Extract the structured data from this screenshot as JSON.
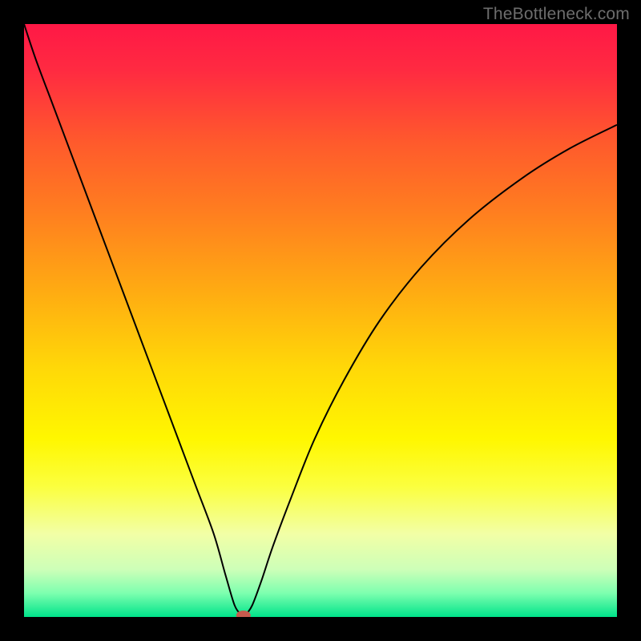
{
  "watermark": "TheBottleneck.com",
  "chart_data": {
    "type": "line",
    "title": "",
    "xlabel": "",
    "ylabel": "",
    "xlim": [
      0,
      100
    ],
    "ylim": [
      0,
      100
    ],
    "background_gradient": {
      "stops": [
        {
          "offset": 0.0,
          "color": "#ff1846"
        },
        {
          "offset": 0.08,
          "color": "#ff2b41"
        },
        {
          "offset": 0.2,
          "color": "#ff5a2c"
        },
        {
          "offset": 0.32,
          "color": "#ff7f1f"
        },
        {
          "offset": 0.45,
          "color": "#ffab12"
        },
        {
          "offset": 0.58,
          "color": "#ffd808"
        },
        {
          "offset": 0.7,
          "color": "#fff700"
        },
        {
          "offset": 0.78,
          "color": "#fbff3f"
        },
        {
          "offset": 0.86,
          "color": "#f2ffa6"
        },
        {
          "offset": 0.92,
          "color": "#cdffb8"
        },
        {
          "offset": 0.96,
          "color": "#7dffaf"
        },
        {
          "offset": 1.0,
          "color": "#00e38a"
        }
      ]
    },
    "series": [
      {
        "name": "bottleneck-curve",
        "color": "#000000",
        "stroke_width": 2,
        "x": [
          0,
          2,
          5,
          8,
          11,
          14,
          17,
          20,
          23,
          26,
          29,
          32,
          34,
          35.5,
          36.5,
          37,
          37.5,
          38.5,
          40,
          42,
          45,
          49,
          54,
          60,
          67,
          75,
          84,
          92,
          100
        ],
        "values": [
          100,
          94,
          86,
          78,
          70,
          62,
          54,
          46,
          38,
          30,
          22,
          14,
          7,
          2,
          0.5,
          0,
          0.5,
          2,
          6,
          12,
          20,
          30,
          40,
          50,
          59,
          67,
          74,
          79,
          83
        ]
      }
    ],
    "marker": {
      "name": "optimal-point",
      "x": 37,
      "y": 0,
      "rx": 9,
      "ry": 6,
      "color": "#c75b4e"
    }
  }
}
